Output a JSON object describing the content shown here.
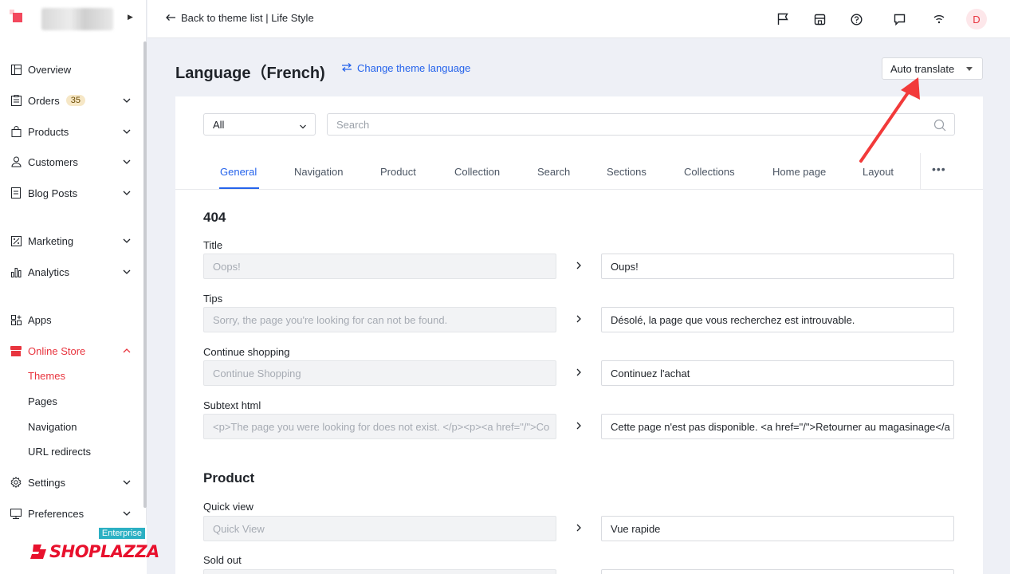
{
  "sidebar": {
    "items": [
      {
        "label": "Overview",
        "icon": "layout-icon"
      },
      {
        "label": "Orders",
        "icon": "clipboard-icon",
        "badge": "35"
      },
      {
        "label": "Products",
        "icon": "bag-icon"
      },
      {
        "label": "Customers",
        "icon": "user-icon"
      },
      {
        "label": "Blog Posts",
        "icon": "document-icon"
      },
      {
        "label": "Marketing",
        "icon": "discount-icon"
      },
      {
        "label": "Analytics",
        "icon": "bar-chart-icon"
      },
      {
        "label": "Apps",
        "icon": "apps-icon"
      },
      {
        "label": "Online Store",
        "icon": "store-icon"
      },
      {
        "label": "Settings",
        "icon": "gear-icon"
      },
      {
        "label": "Preferences",
        "icon": "monitor-icon"
      }
    ],
    "online_store_sub": [
      "Themes",
      "Pages",
      "Navigation",
      "URL redirects"
    ],
    "enterprise": "Enterprise",
    "brand": "SHOPLAZZA"
  },
  "topbar": {
    "back_label": "Back to theme list | Life Style",
    "avatar_initial": "D"
  },
  "header": {
    "title": "Language（French)",
    "change_language": "Change theme language",
    "auto_translate": "Auto translate"
  },
  "filter": {
    "select_value": "All",
    "search_placeholder": "Search"
  },
  "tabs": [
    "General",
    "Navigation",
    "Product",
    "Collection",
    "Search",
    "Sections",
    "Collections",
    "Home page",
    "Layout"
  ],
  "more_label": "•••",
  "sections": [
    {
      "heading": "404",
      "fields": [
        {
          "label": "Title",
          "source": "Oops!",
          "translation": "Oups!"
        },
        {
          "label": "Tips",
          "source": "Sorry, the page you're looking for can not be found.",
          "translation": "Désolé, la page que vous recherchez est introuvable."
        },
        {
          "label": "Continue shopping",
          "source": "Continue Shopping",
          "translation": "Continuez l'achat"
        },
        {
          "label": "Subtext html",
          "source": "<p>The page you were looking for does not exist. </p><p><a href=\"/\">Co",
          "translation": "Cette page n'est pas disponible. <a href=\"/\">Retourner au magasinage</a"
        }
      ]
    },
    {
      "heading": "Product",
      "fields": [
        {
          "label": "Quick view",
          "source": "Quick View",
          "translation": "Vue rapide"
        },
        {
          "label": "Sold out",
          "source": "",
          "translation": ""
        }
      ]
    }
  ],
  "colors": {
    "accent": "#2563eb",
    "brand": "#e8343e",
    "annotation": "#f23a3a"
  }
}
